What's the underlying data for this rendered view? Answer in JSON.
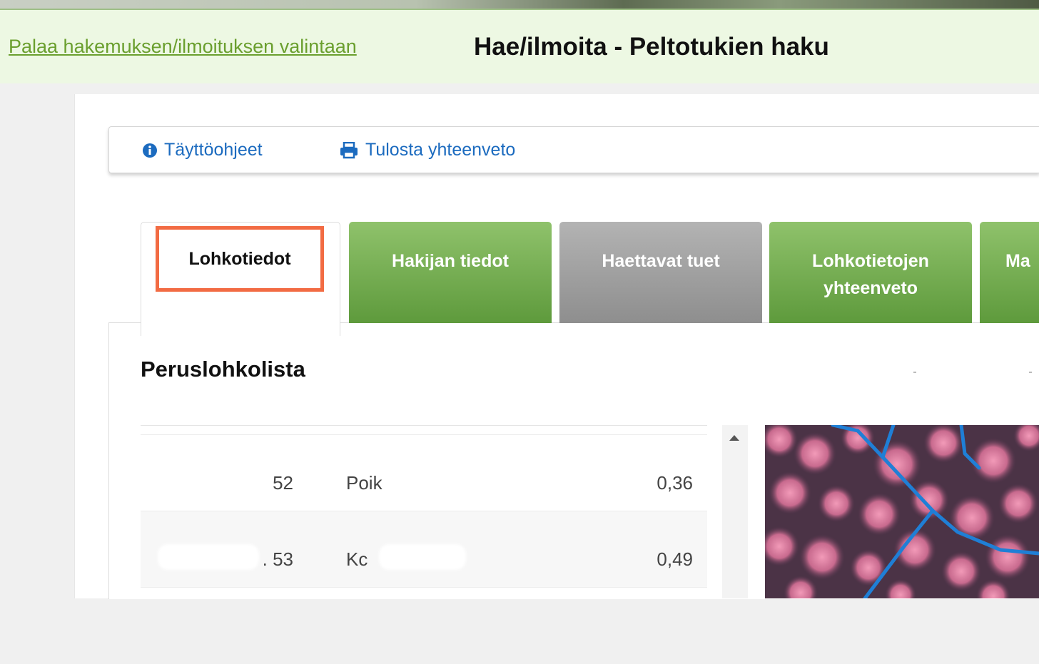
{
  "header": {
    "back_link": "Palaa hakemuksen/ilmoituksen valintaan",
    "title": "Hae/ilmoita - Peltotukien haku"
  },
  "toolbar": {
    "help_label": "Täyttöohjeet",
    "help_icon": "info-circle-icon",
    "print_label": "Tulosta yhteenveto",
    "print_icon": "printer-icon"
  },
  "tabs": [
    {
      "label": "Lohkotiedot",
      "state": "active"
    },
    {
      "label": "Hakijan tiedot",
      "state": "green"
    },
    {
      "label": "Haettavat tuet",
      "state": "gray"
    },
    {
      "label": "Lohkotietojen yhteenveto",
      "state": "green"
    },
    {
      "label": "Ma",
      "state": "green"
    }
  ],
  "section": {
    "title": "Peruslohkolista"
  },
  "list": {
    "rows": [
      {
        "num": "52",
        "name": "Poik",
        "area": "0,36"
      },
      {
        "num": ". 53",
        "name": "Kc",
        "area": "0,49"
      }
    ]
  },
  "colors": {
    "header_bg": "#edf8e3",
    "link": "#6a9f2e",
    "accent_blue": "#1c6bbf",
    "highlight": "#f26b43",
    "tab_green": "#6ca747",
    "tab_gray": "#9e9e9e"
  }
}
